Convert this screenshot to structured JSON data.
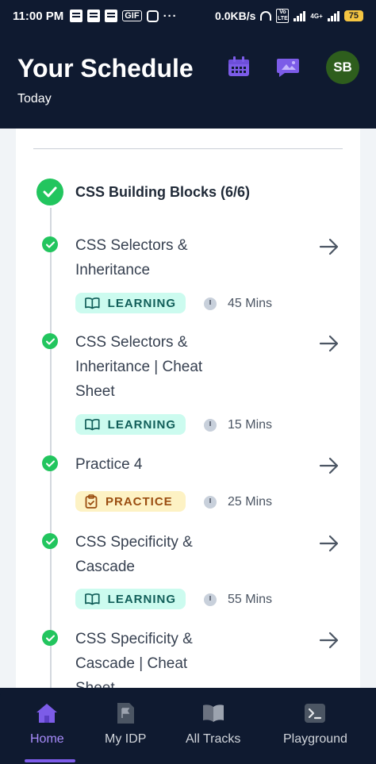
{
  "status_bar": {
    "time": "11:00 PM",
    "network_speed": "0.0KB/s",
    "battery": "75",
    "network_label_1": "Vo LTE",
    "network_label_2": "4G+"
  },
  "header": {
    "title": "Your Schedule",
    "subtitle": "Today",
    "avatar_initials": "SB",
    "calendar_icon": "calendar-icon",
    "message_icon": "image-message-icon",
    "accent_color": "#7c5ce8"
  },
  "section": {
    "title": "CSS Building Blocks (6/6)"
  },
  "items": [
    {
      "title": "CSS Selectors & Inheritance",
      "badge": "LEARNING",
      "type": "learning",
      "duration": "45 Mins"
    },
    {
      "title": "CSS Selectors & Inheritance | Cheat Sheet",
      "badge": "LEARNING",
      "type": "learning",
      "duration": "15 Mins"
    },
    {
      "title": "Practice 4",
      "badge": "PRACTICE",
      "type": "practice",
      "duration": "25 Mins"
    },
    {
      "title": "CSS Specificity & Cascade",
      "badge": "LEARNING",
      "type": "learning",
      "duration": "55 Mins"
    },
    {
      "title": "CSS Specificity & Cascade | Cheat Sheet",
      "badge": "",
      "type": "learning",
      "duration": ""
    }
  ],
  "bottom_nav": [
    {
      "label": "Home",
      "icon": "home-icon",
      "active": true
    },
    {
      "label": "My IDP",
      "icon": "flag-document-icon",
      "active": false
    },
    {
      "label": "All Tracks",
      "icon": "book-icon",
      "active": false
    },
    {
      "label": "Playground",
      "icon": "terminal-icon",
      "active": false
    }
  ]
}
